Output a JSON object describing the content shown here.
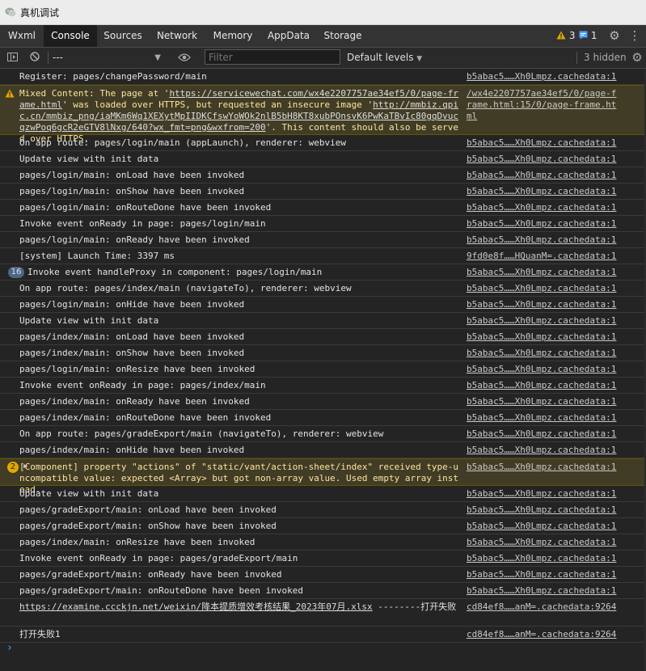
{
  "window": {
    "title": "真机调试",
    "icon": "wechat-devtools-icon"
  },
  "tabs": [
    {
      "label": "Wxml",
      "active": false
    },
    {
      "label": "Console",
      "active": true
    },
    {
      "label": "Sources",
      "active": false
    },
    {
      "label": "Network",
      "active": false
    },
    {
      "label": "Memory",
      "active": false
    },
    {
      "label": "AppData",
      "active": false
    },
    {
      "label": "Storage",
      "active": false
    }
  ],
  "status": {
    "warnings": "3",
    "messages": "1"
  },
  "toolbar": {
    "context": "---",
    "filter_placeholder": "Filter",
    "levels": "Default levels",
    "hidden": "3 hidden"
  },
  "colors": {
    "accent_blue": "#4da3ff",
    "warning": "#e0a800",
    "warning_bg": "#413c26"
  },
  "console": [
    {
      "type": "log",
      "msg": "Register: pages/changePassword/main",
      "src": "b5abac5……Xh0Lmpz.cachedata:1"
    },
    {
      "type": "warn",
      "msg_parts": [
        "Mixed Content: The page at '",
        "https://servicewechat.com/wx4e2207757ae34ef5/0/page-frame.html",
        "' was loaded over HTTPS, but requested an insecure image '",
        "http://mmbiz.qpic.cn/mmbiz_png/iaMKm6Wq1XEXytMpIIDKCfswYoWOk2nlB5bH8KT8xubPOnsvK6PwKaTBvIc80gqDvucqzwPoq6gcR2eGTV8lNxg/640?wx_fmt=png&wxfrom=200",
        "'. This content should also be served over HTTPS."
      ],
      "src": "/wx4e2207757ae34ef5/0/page-frame.html:15/0/page-frame.html"
    },
    {
      "type": "log",
      "msg": "On app route: pages/login/main (appLaunch), renderer: webview",
      "src": "b5abac5……Xh0Lmpz.cachedata:1"
    },
    {
      "type": "log",
      "msg": "Update view with init data",
      "src": "b5abac5……Xh0Lmpz.cachedata:1"
    },
    {
      "type": "log",
      "msg": "pages/login/main: onLoad have been invoked",
      "src": "b5abac5……Xh0Lmpz.cachedata:1"
    },
    {
      "type": "log",
      "msg": "pages/login/main: onShow have been invoked",
      "src": "b5abac5……Xh0Lmpz.cachedata:1"
    },
    {
      "type": "log",
      "msg": "pages/login/main: onRouteDone have been invoked",
      "src": "b5abac5……Xh0Lmpz.cachedata:1"
    },
    {
      "type": "log",
      "msg": "Invoke event onReady in page: pages/login/main",
      "src": "b5abac5……Xh0Lmpz.cachedata:1"
    },
    {
      "type": "log",
      "msg": "pages/login/main: onReady have been invoked",
      "src": "b5abac5……Xh0Lmpz.cachedata:1"
    },
    {
      "type": "log",
      "msg": "[system] Launch Time: 3397 ms",
      "src": "9fd0e8f……HQuanM=.cachedata:1"
    },
    {
      "type": "log",
      "count": "16",
      "msg": "Invoke event handleProxy in component: pages/login/main",
      "src": "b5abac5……Xh0Lmpz.cachedata:1"
    },
    {
      "type": "log",
      "msg": "On app route: pages/index/main (navigateTo), renderer: webview",
      "src": "b5abac5……Xh0Lmpz.cachedata:1"
    },
    {
      "type": "log",
      "msg": "pages/login/main: onHide have been invoked",
      "src": "b5abac5……Xh0Lmpz.cachedata:1"
    },
    {
      "type": "log",
      "msg": "Update view with init data",
      "src": "b5abac5……Xh0Lmpz.cachedata:1"
    },
    {
      "type": "log",
      "msg": "pages/index/main: onLoad have been invoked",
      "src": "b5abac5……Xh0Lmpz.cachedata:1"
    },
    {
      "type": "log",
      "msg": "pages/index/main: onShow have been invoked",
      "src": "b5abac5……Xh0Lmpz.cachedata:1"
    },
    {
      "type": "log",
      "msg": "pages/login/main: onResize have been invoked",
      "src": "b5abac5……Xh0Lmpz.cachedata:1"
    },
    {
      "type": "log",
      "msg": "Invoke event onReady in page: pages/index/main",
      "src": "b5abac5……Xh0Lmpz.cachedata:1"
    },
    {
      "type": "log",
      "msg": "pages/index/main: onReady have been invoked",
      "src": "b5abac5……Xh0Lmpz.cachedata:1"
    },
    {
      "type": "log",
      "msg": "pages/index/main: onRouteDone have been invoked",
      "src": "b5abac5……Xh0Lmpz.cachedata:1"
    },
    {
      "type": "log",
      "msg": "On app route: pages/gradeExport/main (navigateTo), renderer: webview",
      "src": "b5abac5……Xh0Lmpz.cachedata:1"
    },
    {
      "type": "log",
      "msg": "pages/index/main: onHide have been invoked",
      "src": "b5abac5……Xh0Lmpz.cachedata:1"
    },
    {
      "type": "warn",
      "count": "2",
      "msg": "[Component] property \"actions\" of \"static/vant/action-sheet/index\" received type-uncompatible value: expected <Array> but got non-array value. Used empty array instead.",
      "src": "b5abac5……Xh0Lmpz.cachedata:1"
    },
    {
      "type": "log",
      "msg": "Update view with init data",
      "src": "b5abac5……Xh0Lmpz.cachedata:1"
    },
    {
      "type": "log",
      "msg": "pages/gradeExport/main: onLoad have been invoked",
      "src": "b5abac5……Xh0Lmpz.cachedata:1"
    },
    {
      "type": "log",
      "msg": "pages/gradeExport/main: onShow have been invoked",
      "src": "b5abac5……Xh0Lmpz.cachedata:1"
    },
    {
      "type": "log",
      "msg": "pages/index/main: onResize have been invoked",
      "src": "b5abac5……Xh0Lmpz.cachedata:1"
    },
    {
      "type": "log",
      "msg": "Invoke event onReady in page: pages/gradeExport/main",
      "src": "b5abac5……Xh0Lmpz.cachedata:1"
    },
    {
      "type": "log",
      "msg": "pages/gradeExport/main: onReady have been invoked",
      "src": "b5abac5……Xh0Lmpz.cachedata:1"
    },
    {
      "type": "log",
      "msg": "pages/gradeExport/main: onRouteDone have been invoked",
      "src": "b5abac5……Xh0Lmpz.cachedata:1"
    },
    {
      "type": "log",
      "msg_link": "https://examine.ccckjn.net/weixin/降本提质增效考核结果_2023年07月.xlsx",
      "msg_tail": " --------打开失败",
      "src": "cd84ef8……anM=.cachedata:9264"
    },
    {
      "type": "log",
      "msg": "打开失败1",
      "src": "cd84ef8……anM=.cachedata:9264"
    }
  ],
  "prompt_symbol": "›"
}
